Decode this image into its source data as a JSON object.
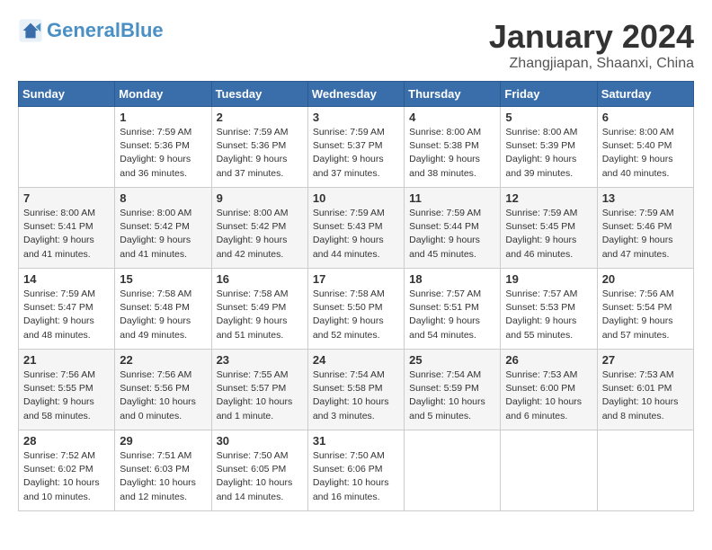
{
  "header": {
    "logo_general": "General",
    "logo_blue": "Blue",
    "title": "January 2024",
    "location": "Zhangjiapan, Shaanxi, China"
  },
  "days_of_week": [
    "Sunday",
    "Monday",
    "Tuesday",
    "Wednesday",
    "Thursday",
    "Friday",
    "Saturday"
  ],
  "weeks": [
    [
      {
        "day": "",
        "info": ""
      },
      {
        "day": "1",
        "info": "Sunrise: 7:59 AM\nSunset: 5:36 PM\nDaylight: 9 hours\nand 36 minutes."
      },
      {
        "day": "2",
        "info": "Sunrise: 7:59 AM\nSunset: 5:36 PM\nDaylight: 9 hours\nand 37 minutes."
      },
      {
        "day": "3",
        "info": "Sunrise: 7:59 AM\nSunset: 5:37 PM\nDaylight: 9 hours\nand 37 minutes."
      },
      {
        "day": "4",
        "info": "Sunrise: 8:00 AM\nSunset: 5:38 PM\nDaylight: 9 hours\nand 38 minutes."
      },
      {
        "day": "5",
        "info": "Sunrise: 8:00 AM\nSunset: 5:39 PM\nDaylight: 9 hours\nand 39 minutes."
      },
      {
        "day": "6",
        "info": "Sunrise: 8:00 AM\nSunset: 5:40 PM\nDaylight: 9 hours\nand 40 minutes."
      }
    ],
    [
      {
        "day": "7",
        "info": "Sunrise: 8:00 AM\nSunset: 5:41 PM\nDaylight: 9 hours\nand 41 minutes."
      },
      {
        "day": "8",
        "info": "Sunrise: 8:00 AM\nSunset: 5:42 PM\nDaylight: 9 hours\nand 41 minutes."
      },
      {
        "day": "9",
        "info": "Sunrise: 8:00 AM\nSunset: 5:42 PM\nDaylight: 9 hours\nand 42 minutes."
      },
      {
        "day": "10",
        "info": "Sunrise: 7:59 AM\nSunset: 5:43 PM\nDaylight: 9 hours\nand 44 minutes."
      },
      {
        "day": "11",
        "info": "Sunrise: 7:59 AM\nSunset: 5:44 PM\nDaylight: 9 hours\nand 45 minutes."
      },
      {
        "day": "12",
        "info": "Sunrise: 7:59 AM\nSunset: 5:45 PM\nDaylight: 9 hours\nand 46 minutes."
      },
      {
        "day": "13",
        "info": "Sunrise: 7:59 AM\nSunset: 5:46 PM\nDaylight: 9 hours\nand 47 minutes."
      }
    ],
    [
      {
        "day": "14",
        "info": "Sunrise: 7:59 AM\nSunset: 5:47 PM\nDaylight: 9 hours\nand 48 minutes."
      },
      {
        "day": "15",
        "info": "Sunrise: 7:58 AM\nSunset: 5:48 PM\nDaylight: 9 hours\nand 49 minutes."
      },
      {
        "day": "16",
        "info": "Sunrise: 7:58 AM\nSunset: 5:49 PM\nDaylight: 9 hours\nand 51 minutes."
      },
      {
        "day": "17",
        "info": "Sunrise: 7:58 AM\nSunset: 5:50 PM\nDaylight: 9 hours\nand 52 minutes."
      },
      {
        "day": "18",
        "info": "Sunrise: 7:57 AM\nSunset: 5:51 PM\nDaylight: 9 hours\nand 54 minutes."
      },
      {
        "day": "19",
        "info": "Sunrise: 7:57 AM\nSunset: 5:53 PM\nDaylight: 9 hours\nand 55 minutes."
      },
      {
        "day": "20",
        "info": "Sunrise: 7:56 AM\nSunset: 5:54 PM\nDaylight: 9 hours\nand 57 minutes."
      }
    ],
    [
      {
        "day": "21",
        "info": "Sunrise: 7:56 AM\nSunset: 5:55 PM\nDaylight: 9 hours\nand 58 minutes."
      },
      {
        "day": "22",
        "info": "Sunrise: 7:56 AM\nSunset: 5:56 PM\nDaylight: 10 hours\nand 0 minutes."
      },
      {
        "day": "23",
        "info": "Sunrise: 7:55 AM\nSunset: 5:57 PM\nDaylight: 10 hours\nand 1 minute."
      },
      {
        "day": "24",
        "info": "Sunrise: 7:54 AM\nSunset: 5:58 PM\nDaylight: 10 hours\nand 3 minutes."
      },
      {
        "day": "25",
        "info": "Sunrise: 7:54 AM\nSunset: 5:59 PM\nDaylight: 10 hours\nand 5 minutes."
      },
      {
        "day": "26",
        "info": "Sunrise: 7:53 AM\nSunset: 6:00 PM\nDaylight: 10 hours\nand 6 minutes."
      },
      {
        "day": "27",
        "info": "Sunrise: 7:53 AM\nSunset: 6:01 PM\nDaylight: 10 hours\nand 8 minutes."
      }
    ],
    [
      {
        "day": "28",
        "info": "Sunrise: 7:52 AM\nSunset: 6:02 PM\nDaylight: 10 hours\nand 10 minutes."
      },
      {
        "day": "29",
        "info": "Sunrise: 7:51 AM\nSunset: 6:03 PM\nDaylight: 10 hours\nand 12 minutes."
      },
      {
        "day": "30",
        "info": "Sunrise: 7:50 AM\nSunset: 6:05 PM\nDaylight: 10 hours\nand 14 minutes."
      },
      {
        "day": "31",
        "info": "Sunrise: 7:50 AM\nSunset: 6:06 PM\nDaylight: 10 hours\nand 16 minutes."
      },
      {
        "day": "",
        "info": ""
      },
      {
        "day": "",
        "info": ""
      },
      {
        "day": "",
        "info": ""
      }
    ]
  ]
}
